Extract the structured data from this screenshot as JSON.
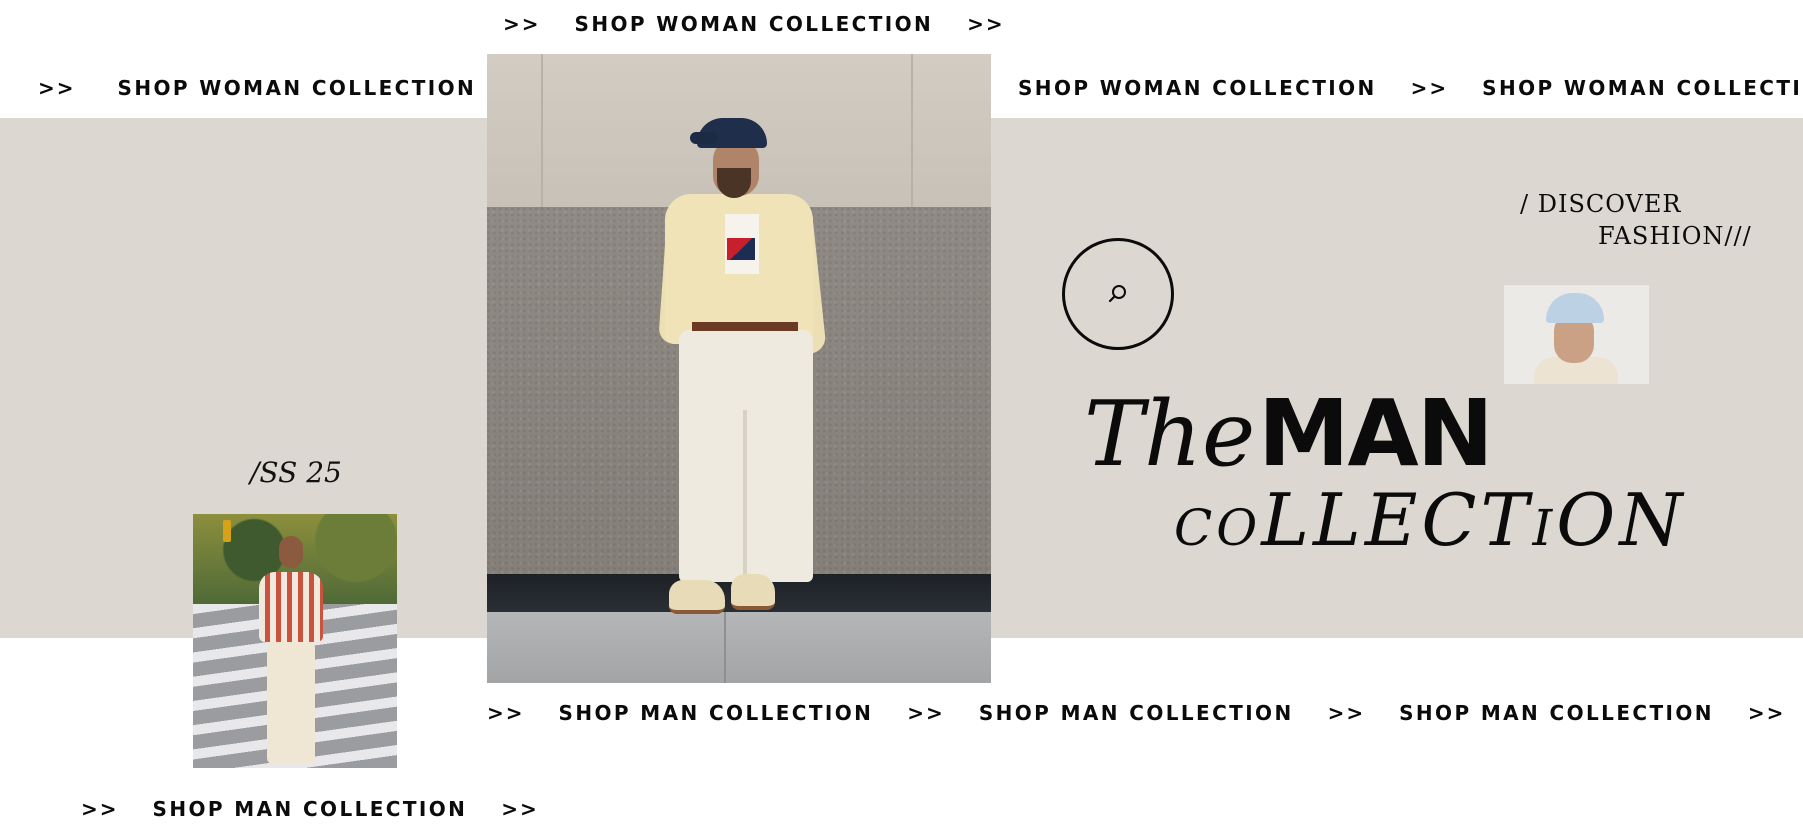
{
  "colors": {
    "band": "#dcd8d1",
    "text": "#0b0b0b",
    "background": "#ffffff"
  },
  "marquees": {
    "top_center": {
      "arrow_left": ">>",
      "label": "SHOP WOMAN COLLECTION",
      "arrow_right": ">>"
    },
    "woman_left": {
      "arrow": ">>",
      "label": "SHOP WOMAN COLLECTION"
    },
    "woman_right": {
      "label_1": "SHOP WOMAN COLLECTION",
      "arrow": ">>",
      "label_2": "SHOP WOMAN COLLECTION"
    },
    "man_middle": {
      "arrow_1": ">>",
      "label_1": "SHOP MAN COLLECTION",
      "arrow_2": ">>",
      "label_2": "SHOP MAN COLLECTION",
      "arrow_3": ">>",
      "label_3": "SHOP MAN COLLECTION",
      "arrow_4": ">>"
    },
    "man_bottom": {
      "arrow_left": ">>",
      "label": "SHOP MAN COLLECTION",
      "arrow_right": ">>"
    }
  },
  "discover": {
    "line1": "/ DISCOVER",
    "line2": "FASHION///"
  },
  "season": "/SS 25",
  "headline": {
    "the": "The",
    "man": "MAN",
    "collection": "coLLECTiON"
  },
  "circle_button": {
    "icon": "search-icon"
  },
  "images": {
    "main": "man-standing-against-wall-photo",
    "crosswalk": "man-crossing-street-photo",
    "cap": "man-in-light-blue-cap-photo"
  }
}
